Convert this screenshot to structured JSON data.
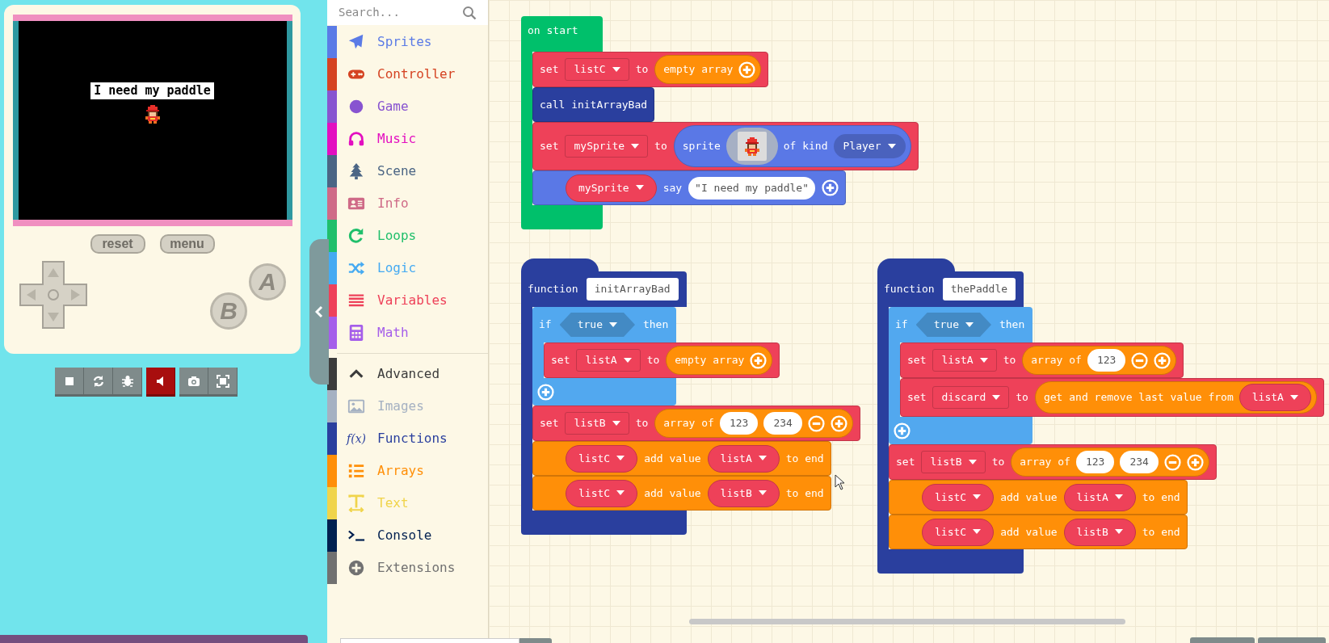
{
  "simulator": {
    "screen_text": "I need my paddle",
    "buttons": [
      {
        "label": "reset"
      },
      {
        "label": "menu"
      }
    ],
    "a_label": "A",
    "b_label": "B",
    "toolbar": [
      {
        "kind": "stop",
        "active": false
      },
      {
        "kind": "restart",
        "active": false
      },
      {
        "kind": "debug",
        "active": false
      },
      {
        "kind": "sound",
        "active": true
      },
      {
        "kind": "screenshot",
        "active": false
      },
      {
        "kind": "fullscreen",
        "active": false
      }
    ]
  },
  "search": {
    "placeholder": "Search..."
  },
  "toolbox": {
    "categories": [
      {
        "label": "Sprites",
        "kind": "sprites",
        "color": "#5b7be6"
      },
      {
        "label": "Controller",
        "kind": "controller",
        "color": "#d54322"
      },
      {
        "label": "Game",
        "kind": "game",
        "color": "#8854d0"
      },
      {
        "label": "Music",
        "kind": "music",
        "color": "#e30fc0"
      },
      {
        "label": "Scene",
        "kind": "scene",
        "color": "#4b6584"
      },
      {
        "label": "Info",
        "kind": "info",
        "color": "#cf6a87"
      },
      {
        "label": "Loops",
        "kind": "loops",
        "color": "#20bf6b"
      },
      {
        "label": "Logic",
        "kind": "logic",
        "color": "#45aaf2"
      },
      {
        "label": "Variables",
        "kind": "variables",
        "color": "#ee4159"
      },
      {
        "label": "Math",
        "kind": "math",
        "color": "#a55eea"
      }
    ],
    "advanced": [
      {
        "label": "Advanced",
        "kind": "advanced",
        "color": "#3c3c3c"
      },
      {
        "label": "Images",
        "kind": "images",
        "color": "#a5b1c2"
      },
      {
        "label": "Functions",
        "kind": "functions",
        "color": "#2a3f9e",
        "icon_text": "f(x)"
      },
      {
        "label": "Arrays",
        "kind": "arrays",
        "color": "#ff8f08"
      },
      {
        "label": "Text",
        "kind": "text",
        "color": "#f0d44b"
      },
      {
        "label": "Console",
        "kind": "console",
        "color": "#002050"
      },
      {
        "label": "Extensions",
        "kind": "extensions",
        "color": "#717171"
      }
    ]
  },
  "workspace": {
    "stacks": [
      {
        "kind": "on_start",
        "color": "#00c06b",
        "parts": [
          {
            "kind": "label",
            "text": "on start"
          }
        ],
        "body": [
          {
            "kind": "statement",
            "color": "#ee4159",
            "parts": [
              {
                "kind": "label",
                "text": "set"
              },
              {
                "kind": "dropdown",
                "text": "listC"
              },
              {
                "kind": "label",
                "text": "to"
              },
              {
                "kind": "reporter",
                "color": "#ff8f08",
                "parts": [
                  {
                    "kind": "label",
                    "text": "empty array"
                  },
                  {
                    "kind": "plus"
                  }
                ]
              }
            ]
          },
          {
            "kind": "statement",
            "color": "#2a3f9e",
            "parts": [
              {
                "kind": "label",
                "text": "call initArrayBad"
              }
            ]
          },
          {
            "kind": "statement",
            "color": "#ee4159",
            "parts": [
              {
                "kind": "label",
                "text": "set"
              },
              {
                "kind": "dropdown",
                "text": "mySprite"
              },
              {
                "kind": "label",
                "text": "to"
              },
              {
                "kind": "reporter",
                "color": "#5a78e6",
                "parts": [
                  {
                    "kind": "label",
                    "text": "sprite"
                  },
                  {
                    "kind": "sprite"
                  },
                  {
                    "kind": "label",
                    "text": "of kind"
                  },
                  {
                    "kind": "kind_dropdown",
                    "text": "Player"
                  }
                ]
              }
            ]
          },
          {
            "kind": "statement",
            "color": "#5a78e6",
            "parts": [
              {
                "kind": "pill_dropdown",
                "color": "#ee4159",
                "text": "mySprite"
              },
              {
                "kind": "label",
                "text": "say"
              },
              {
                "kind": "string",
                "text": "\"I need my paddle\""
              },
              {
                "kind": "plus"
              }
            ]
          }
        ]
      },
      {
        "kind": "function",
        "color": "#2a3f9e",
        "parts": [
          {
            "kind": "label",
            "text": "function"
          },
          {
            "kind": "name",
            "text": "initArrayBad"
          }
        ],
        "body": [
          {
            "kind": "if",
            "color": "#52a8ef",
            "parts": [
              {
                "kind": "label",
                "text": "if"
              },
              {
                "kind": "bool",
                "text": "true"
              },
              {
                "kind": "label",
                "text": "then"
              }
            ],
            "body": [
              {
                "kind": "statement",
                "color": "#ee4159",
                "parts": [
                  {
                    "kind": "label",
                    "text": "set"
                  },
                  {
                    "kind": "dropdown",
                    "text": "listA"
                  },
                  {
                    "kind": "label",
                    "text": "to"
                  },
                  {
                    "kind": "reporter",
                    "color": "#ff8f08",
                    "parts": [
                      {
                        "kind": "label",
                        "text": "empty array"
                      },
                      {
                        "kind": "plus"
                      }
                    ]
                  }
                ]
              }
            ]
          },
          {
            "kind": "statement",
            "color": "#ee4159",
            "parts": [
              {
                "kind": "label",
                "text": "set"
              },
              {
                "kind": "dropdown",
                "text": "listB"
              },
              {
                "kind": "label",
                "text": "to"
              },
              {
                "kind": "reporter",
                "color": "#ff8f08",
                "parts": [
                  {
                    "kind": "label",
                    "text": "array of"
                  },
                  {
                    "kind": "number",
                    "text": "123"
                  },
                  {
                    "kind": "number",
                    "text": "234"
                  },
                  {
                    "kind": "minus"
                  },
                  {
                    "kind": "plus"
                  }
                ]
              }
            ]
          },
          {
            "kind": "statement",
            "color": "#ff8f08",
            "parts": [
              {
                "kind": "pill_dropdown",
                "color": "#ee4159",
                "text": "listC"
              },
              {
                "kind": "label",
                "text": "add value"
              },
              {
                "kind": "pill_dropdown",
                "color": "#ee4159",
                "text": "listA"
              },
              {
                "kind": "label",
                "text": "to end"
              }
            ]
          },
          {
            "kind": "statement",
            "color": "#ff8f08",
            "parts": [
              {
                "kind": "pill_dropdown",
                "color": "#ee4159",
                "text": "listC"
              },
              {
                "kind": "label",
                "text": "add value"
              },
              {
                "kind": "pill_dropdown",
                "color": "#ee4159",
                "text": "listB"
              },
              {
                "kind": "label",
                "text": "to end"
              }
            ]
          }
        ]
      },
      {
        "kind": "function",
        "color": "#2a3f9e",
        "parts": [
          {
            "kind": "label",
            "text": "function"
          },
          {
            "kind": "name",
            "text": "thePaddle"
          }
        ],
        "body": [
          {
            "kind": "if",
            "color": "#52a8ef",
            "parts": [
              {
                "kind": "label",
                "text": "if"
              },
              {
                "kind": "bool",
                "text": "true"
              },
              {
                "kind": "label",
                "text": "then"
              }
            ],
            "body": [
              {
                "kind": "statement",
                "color": "#ee4159",
                "parts": [
                  {
                    "kind": "label",
                    "text": "set"
                  },
                  {
                    "kind": "dropdown",
                    "text": "listA"
                  },
                  {
                    "kind": "label",
                    "text": "to"
                  },
                  {
                    "kind": "reporter",
                    "color": "#ff8f08",
                    "parts": [
                      {
                        "kind": "label",
                        "text": "array of"
                      },
                      {
                        "kind": "number",
                        "text": "123"
                      },
                      {
                        "kind": "minus"
                      },
                      {
                        "kind": "plus"
                      }
                    ]
                  }
                ]
              },
              {
                "kind": "statement",
                "color": "#ee4159",
                "parts": [
                  {
                    "kind": "label",
                    "text": "set"
                  },
                  {
                    "kind": "dropdown",
                    "text": "discard"
                  },
                  {
                    "kind": "label",
                    "text": "to"
                  },
                  {
                    "kind": "reporter",
                    "color": "#ff8f08",
                    "parts": [
                      {
                        "kind": "label",
                        "text": "get and remove last value from"
                      },
                      {
                        "kind": "pill_dropdown",
                        "color": "#ee4159",
                        "text": "listA"
                      }
                    ]
                  }
                ]
              }
            ]
          },
          {
            "kind": "statement",
            "color": "#ee4159",
            "parts": [
              {
                "kind": "label",
                "text": "set"
              },
              {
                "kind": "dropdown",
                "text": "listB"
              },
              {
                "kind": "label",
                "text": "to"
              },
              {
                "kind": "reporter",
                "color": "#ff8f08",
                "parts": [
                  {
                    "kind": "label",
                    "text": "array of"
                  },
                  {
                    "kind": "number",
                    "text": "123"
                  },
                  {
                    "kind": "number",
                    "text": "234"
                  },
                  {
                    "kind": "minus"
                  },
                  {
                    "kind": "plus"
                  }
                ]
              }
            ]
          },
          {
            "kind": "statement",
            "color": "#ff8f08",
            "parts": [
              {
                "kind": "pill_dropdown",
                "color": "#ee4159",
                "text": "listC"
              },
              {
                "kind": "label",
                "text": "add value"
              },
              {
                "kind": "pill_dropdown",
                "color": "#ee4159",
                "text": "listA"
              },
              {
                "kind": "label",
                "text": "to end"
              }
            ]
          },
          {
            "kind": "statement",
            "color": "#ff8f08",
            "parts": [
              {
                "kind": "pill_dropdown",
                "color": "#ee4159",
                "text": "listC"
              },
              {
                "kind": "label",
                "text": "add value"
              },
              {
                "kind": "pill_dropdown",
                "color": "#ee4159",
                "text": "listB"
              },
              {
                "kind": "label",
                "text": "to end"
              }
            ]
          }
        ]
      }
    ]
  }
}
